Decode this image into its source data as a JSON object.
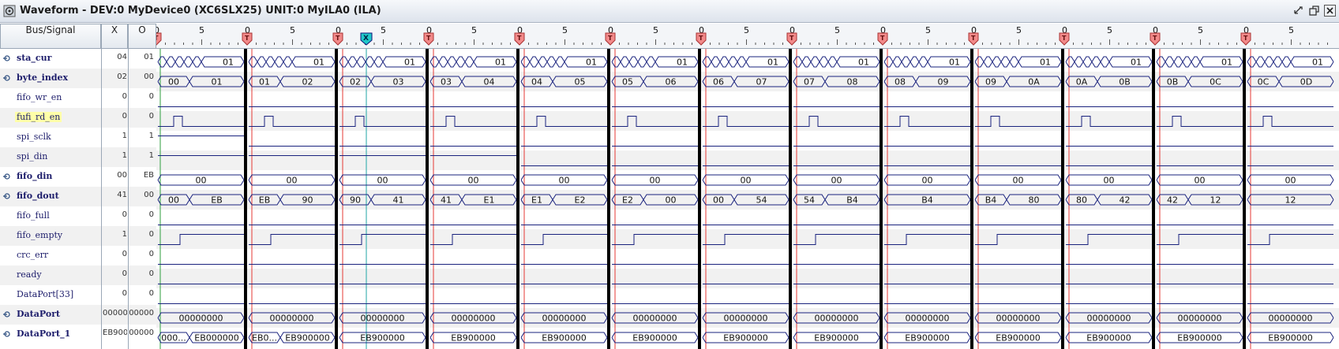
{
  "window": {
    "title": "Waveform - DEV:0 MyDevice0 (XC6SLX25) UNIT:0 MyILA0 (ILA)",
    "icon": "waveform-app-icon",
    "controls": [
      "minimize-icon",
      "restore-icon",
      "close-icon"
    ]
  },
  "columns": {
    "signal": "Bus/Signal",
    "x": "X",
    "o": "O"
  },
  "ruler": {
    "segment_labels": [
      "0",
      "5"
    ],
    "trigger_marker": "T",
    "cursor_marker": "X",
    "segments": 13
  },
  "signals": [
    {
      "name": "sta_cur",
      "bus": true,
      "x": "04",
      "o": "01",
      "segments": [
        {
          "type": "xs",
          "label": "01"
        }
      ]
    },
    {
      "name": "byte_index",
      "bus": true,
      "x": "02",
      "o": "00",
      "segments": [
        {
          "type": "vals",
          "labels": [
            "00",
            "01"
          ]
        },
        {
          "type": "vals",
          "labels": [
            "01",
            "02"
          ]
        },
        {
          "type": "vals",
          "labels": [
            "02",
            "03"
          ]
        },
        {
          "type": "vals",
          "labels": [
            "03",
            "04"
          ]
        },
        {
          "type": "vals",
          "labels": [
            "04",
            "05"
          ]
        },
        {
          "type": "vals",
          "labels": [
            "05",
            "06"
          ]
        },
        {
          "type": "vals",
          "labels": [
            "06",
            "07"
          ]
        },
        {
          "type": "vals",
          "labels": [
            "07",
            "08"
          ]
        },
        {
          "type": "vals",
          "labels": [
            "08",
            "09"
          ]
        },
        {
          "type": "vals",
          "labels": [
            "09",
            "0A"
          ]
        },
        {
          "type": "vals",
          "labels": [
            "0A",
            "0B"
          ]
        },
        {
          "type": "vals",
          "labels": [
            "0B",
            "0C"
          ]
        },
        {
          "type": "vals",
          "labels": [
            "0C",
            "0D"
          ]
        }
      ]
    },
    {
      "name": "fifo_wr_en",
      "bus": false,
      "x": "0",
      "o": "0",
      "segments": [
        {
          "type": "low"
        }
      ]
    },
    {
      "name": "fufi_rd_en",
      "bus": false,
      "highlight": true,
      "x": "0",
      "o": "0",
      "segments": [
        {
          "type": "pulse"
        }
      ]
    },
    {
      "name": "spi_sclk",
      "bus": false,
      "x": "1",
      "o": "1",
      "segments": [
        {
          "type": "high"
        },
        {
          "type": "low"
        },
        {
          "type": "low"
        },
        {
          "type": "low"
        },
        {
          "type": "low"
        },
        {
          "type": "low"
        },
        {
          "type": "low"
        },
        {
          "type": "low"
        },
        {
          "type": "low"
        },
        {
          "type": "low"
        },
        {
          "type": "low"
        },
        {
          "type": "low"
        },
        {
          "type": "low"
        }
      ]
    },
    {
      "name": "spi_din",
      "bus": false,
      "x": "1",
      "o": "1",
      "segments": [
        {
          "type": "high"
        },
        {
          "type": "high"
        },
        {
          "type": "high"
        },
        {
          "type": "high"
        },
        {
          "type": "low"
        },
        {
          "type": "low"
        },
        {
          "type": "low"
        },
        {
          "type": "low"
        },
        {
          "type": "low"
        },
        {
          "type": "low"
        },
        {
          "type": "low"
        },
        {
          "type": "low"
        },
        {
          "type": "low"
        }
      ]
    },
    {
      "name": "fifo_din",
      "bus": true,
      "x": "00",
      "o": "EB",
      "segments": [
        {
          "type": "value",
          "label": "00"
        }
      ]
    },
    {
      "name": "fifo_dout",
      "bus": true,
      "x": "41",
      "o": "00",
      "segments": [
        {
          "type": "vals",
          "labels": [
            "00",
            "EB"
          ]
        },
        {
          "type": "vals",
          "labels": [
            "EB",
            "90"
          ]
        },
        {
          "type": "vals",
          "labels": [
            "90",
            "41"
          ]
        },
        {
          "type": "vals",
          "labels": [
            "41",
            "E1"
          ]
        },
        {
          "type": "vals",
          "labels": [
            "E1",
            "E2"
          ]
        },
        {
          "type": "vals",
          "labels": [
            "E2",
            "00"
          ]
        },
        {
          "type": "vals",
          "labels": [
            "00",
            "54"
          ]
        },
        {
          "type": "vals",
          "labels": [
            "54",
            "B4"
          ]
        },
        {
          "type": "value",
          "label": "B4"
        },
        {
          "type": "vals",
          "labels": [
            "B4",
            "80"
          ]
        },
        {
          "type": "vals",
          "labels": [
            "80",
            "42"
          ]
        },
        {
          "type": "vals",
          "labels": [
            "42",
            "12"
          ]
        },
        {
          "type": "value",
          "label": "12"
        }
      ]
    },
    {
      "name": "fifo_full",
      "bus": false,
      "x": "0",
      "o": "0",
      "segments": [
        {
          "type": "low"
        }
      ]
    },
    {
      "name": "fifo_empty",
      "bus": false,
      "x": "1",
      "o": "0",
      "segments": [
        {
          "type": "rise"
        }
      ]
    },
    {
      "name": "crc_err",
      "bus": false,
      "x": "0",
      "o": "0",
      "segments": [
        {
          "type": "low"
        }
      ]
    },
    {
      "name": "ready",
      "bus": false,
      "x": "0",
      "o": "0",
      "segments": [
        {
          "type": "low"
        }
      ]
    },
    {
      "name": "DataPort[33]",
      "bus": false,
      "x": "0",
      "o": "0",
      "segments": [
        {
          "type": "low"
        }
      ]
    },
    {
      "name": "DataPort",
      "bus": true,
      "x": "00000",
      "o": "00000",
      "segments": [
        {
          "type": "value",
          "label": "00000000"
        }
      ]
    },
    {
      "name": "DataPort_1",
      "bus": true,
      "x": "EB900",
      "o": "00000",
      "segments": [
        {
          "type": "vals",
          "labels": [
            "000...",
            "EB000000"
          ]
        },
        {
          "type": "vals",
          "labels": [
            "EB0...",
            "EB900000"
          ]
        },
        {
          "type": "value",
          "label": "EB900000"
        }
      ]
    }
  ],
  "colors": {
    "waveform": "#1a237e",
    "marker_bar": "#000000",
    "trigger_line": "#e53935",
    "trigger_marker": "#f28a8a",
    "cursor_line": "#1fa6a6",
    "start_line": "#2e9e3e",
    "row_alt": "#f1f1f1"
  }
}
